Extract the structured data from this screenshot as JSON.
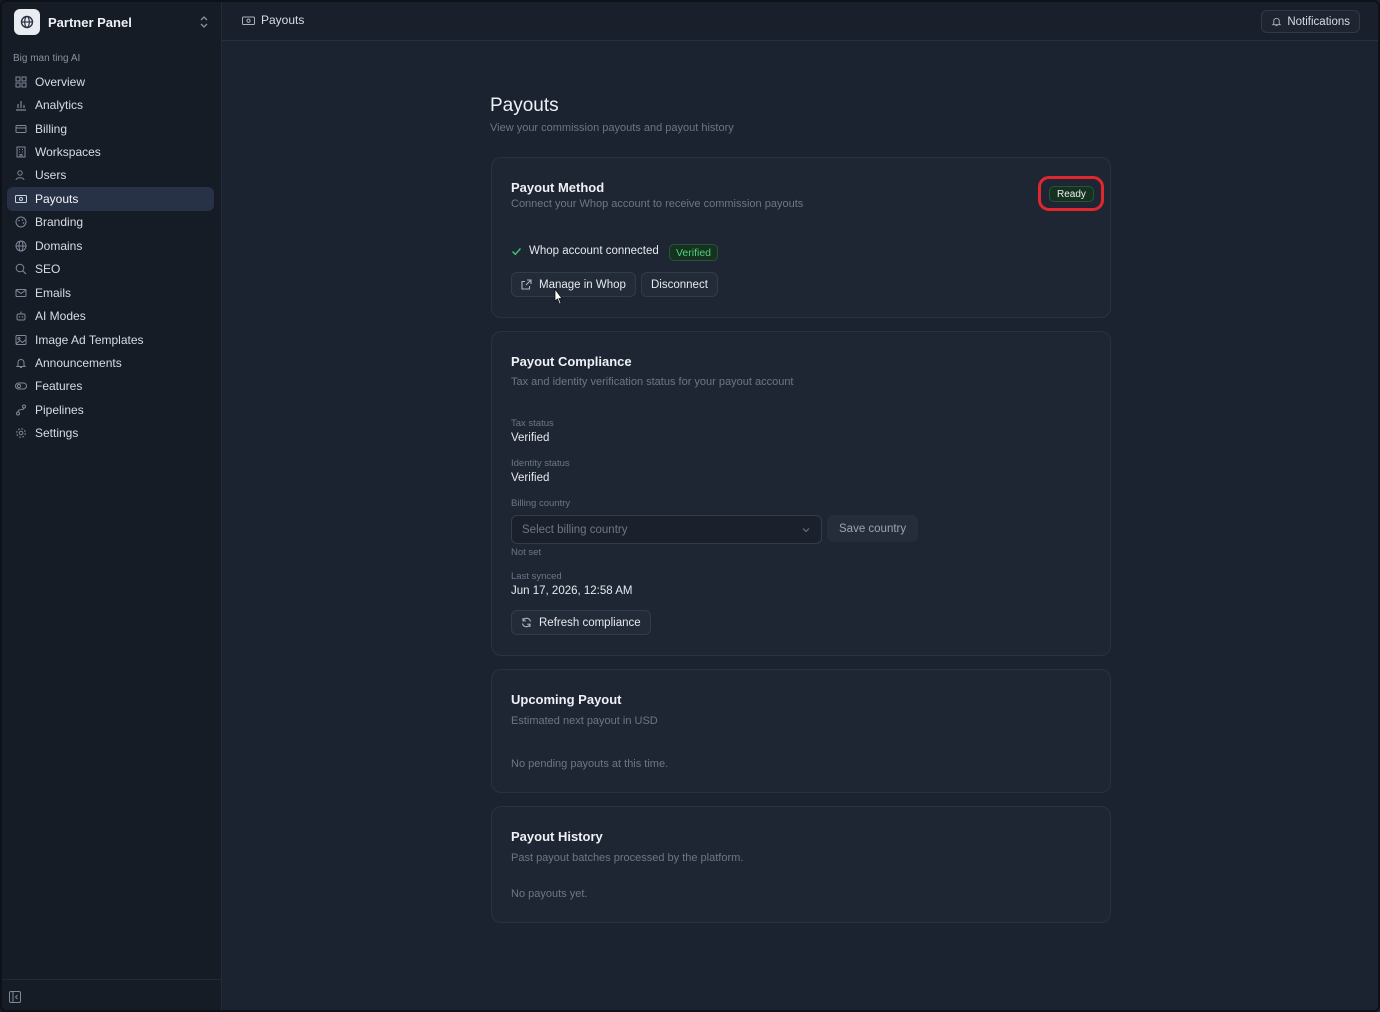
{
  "sidebar": {
    "app_name": "Partner Panel",
    "org_name": "Big man ting AI",
    "items": [
      {
        "label": "Overview",
        "icon": "overview-icon"
      },
      {
        "label": "Analytics",
        "icon": "analytics-icon"
      },
      {
        "label": "Billing",
        "icon": "billing-icon"
      },
      {
        "label": "Workspaces",
        "icon": "workspaces-icon"
      },
      {
        "label": "Users",
        "icon": "users-icon"
      },
      {
        "label": "Payouts",
        "icon": "payouts-icon",
        "active": true
      },
      {
        "label": "Branding",
        "icon": "branding-icon"
      },
      {
        "label": "Domains",
        "icon": "domains-icon"
      },
      {
        "label": "SEO",
        "icon": "search-icon"
      },
      {
        "label": "Emails",
        "icon": "mail-icon"
      },
      {
        "label": "AI Modes",
        "icon": "ai-modes-icon"
      },
      {
        "label": "Image Ad Templates",
        "icon": "image-icon"
      },
      {
        "label": "Announcements",
        "icon": "bell-icon"
      },
      {
        "label": "Features",
        "icon": "toggle-icon"
      },
      {
        "label": "Pipelines",
        "icon": "pipeline-icon"
      },
      {
        "label": "Settings",
        "icon": "gear-icon"
      }
    ]
  },
  "topbar": {
    "breadcrumb": "Payouts",
    "notifications_label": "Notifications"
  },
  "page": {
    "title": "Payouts",
    "subtitle": "View your commission payouts and payout history"
  },
  "payout_method": {
    "title": "Payout Method",
    "subtitle": "Connect your Whop account to receive commission payouts",
    "status_badge": "Ready",
    "connected_text": "Whop account connected",
    "verified_badge": "Verified",
    "manage_button": "Manage in Whop",
    "disconnect_button": "Disconnect"
  },
  "compliance": {
    "title": "Payout Compliance",
    "subtitle": "Tax and identity verification status for your payout account",
    "tax_status_label": "Tax status",
    "tax_status_value": "Verified",
    "identity_status_label": "Identity status",
    "identity_status_value": "Verified",
    "billing_country_label": "Billing country",
    "billing_country_placeholder": "Select billing country",
    "save_country_button": "Save country",
    "billing_country_note": "Not set",
    "last_synced_label": "Last synced",
    "last_synced_value": "Jun 17, 2026, 12:58 AM",
    "refresh_button": "Refresh compliance"
  },
  "upcoming": {
    "title": "Upcoming Payout",
    "subtitle": "Estimated next payout in USD",
    "empty_text": "No pending payouts at this time."
  },
  "history": {
    "title": "Payout History",
    "subtitle": "Past payout batches processed by the platform.",
    "empty_text": "No payouts yet."
  },
  "colors": {
    "background": "#1b2230",
    "sidebar": "#161c26",
    "card": "#1f2633",
    "success": "#3fc46f",
    "highlight_ring": "#e0262f"
  }
}
